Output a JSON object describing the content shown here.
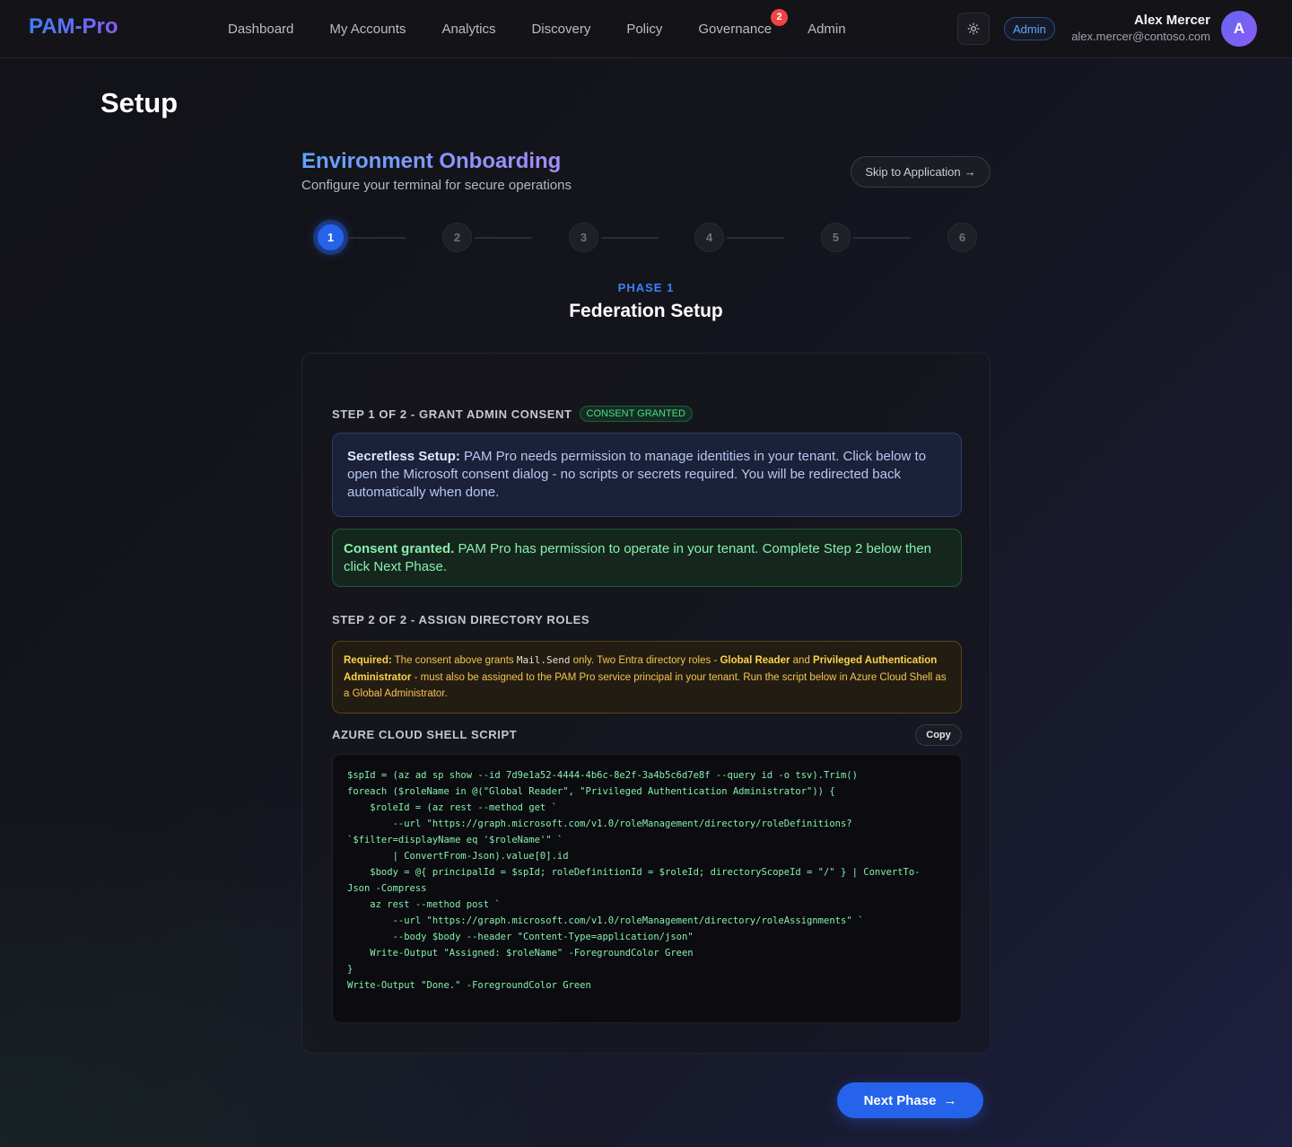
{
  "brand": "PAM-Pro",
  "nav": {
    "items": [
      {
        "label": "Dashboard"
      },
      {
        "label": "My Accounts"
      },
      {
        "label": "Analytics"
      },
      {
        "label": "Discovery"
      },
      {
        "label": "Policy"
      },
      {
        "label": "Governance",
        "badge": "2"
      },
      {
        "label": "Admin"
      }
    ],
    "theme_icon": "sun-icon",
    "role": "Admin",
    "user_name": "Alex Mercer",
    "user_email": "alex.mercer@contoso.com",
    "avatar_initial": "A"
  },
  "page_title": "Setup",
  "onboarding": {
    "title": "Environment Onboarding",
    "subtitle": "Configure your terminal for secure operations",
    "skip_label": "Skip to Application",
    "skip_icon": "→"
  },
  "stepper": {
    "steps": [
      "1",
      "2",
      "3",
      "4",
      "5",
      "6"
    ],
    "current": 1
  },
  "phase": {
    "label": "PHASE 1",
    "title": "Federation Setup"
  },
  "step1": {
    "heading": "STEP 1 OF 2 - GRANT ADMIN CONSENT",
    "badge": "CONSENT GRANTED",
    "info_bold": "Secretless Setup:",
    "info_text": " PAM Pro needs permission to manage identities in your tenant. Click below to open the Microsoft consent dialog - no scripts or secrets required. You will be redirected back automatically when done.",
    "ok_bold": "Consent granted.",
    "ok_text": " PAM Pro has permission to operate in your tenant. Complete Step 2 below then click Next Phase."
  },
  "step2": {
    "heading": "STEP 2 OF 2 - ASSIGN DIRECTORY ROLES",
    "warn_bold": "Required:",
    "warn_text_1": " The consent above grants ",
    "warn_code": "Mail.Send",
    "warn_text_2": " only. Two Entra directory roles - ",
    "warn_role_1": "Global Reader",
    "warn_text_3": " and ",
    "warn_role_2": "Privileged Authentication Administrator",
    "warn_text_4": " - must also be assigned to the PAM Pro service principal in your tenant. Run the script below in Azure Cloud Shell as a Global Administrator.",
    "script_label": "AZURE CLOUD SHELL SCRIPT",
    "copy_label": "Copy",
    "script_lines": [
      "$spId = (az ad sp show --id 7d9e1a52-4444-4b6c-8e2f-3a4b5c6d7e8f --query id -o tsv).Trim()",
      "",
      "foreach ($roleName in @(\"Global Reader\", \"Privileged Authentication Administrator\")) {",
      "    $roleId = (az rest --method get `",
      "        --url \"https://graph.microsoft.com/v1.0/roleManagement/directory/roleDefinitions?",
      "`$filter=displayName eq '$roleName'\" `",
      "        | ConvertFrom-Json).value[0].id",
      "    $body = @{ principalId = $spId; roleDefinitionId = $roleId; directoryScopeId = \"/\" } | ConvertTo-",
      "Json -Compress",
      "    az rest --method post `",
      "        --url \"https://graph.microsoft.com/v1.0/roleManagement/directory/roleAssignments\" `",
      "        --body $body --header \"Content-Type=application/json\"",
      "    Write-Output \"Assigned: $roleName\" -ForegroundColor Green",
      "}",
      "Write-Output \"Done.\" -ForegroundColor Green"
    ]
  },
  "next_label": "Next Phase",
  "next_icon": "→",
  "colors": {
    "accent": "#2563eb",
    "success": "#4ade80",
    "warning": "#fcd34d",
    "badge": "#ef4444"
  }
}
